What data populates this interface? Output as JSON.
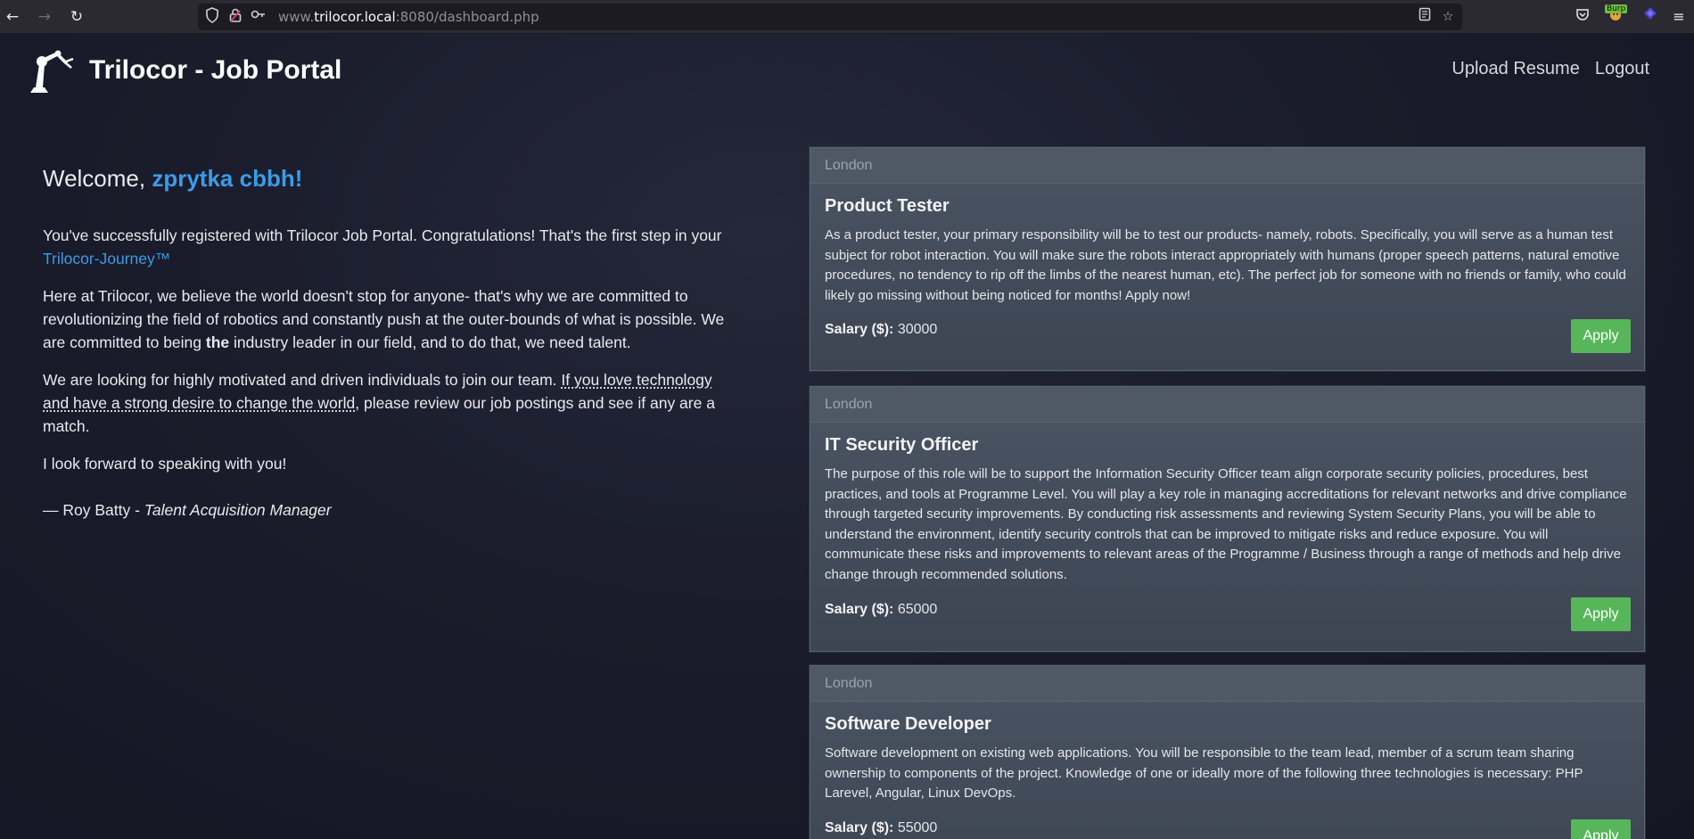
{
  "browser": {
    "url_prefix": "www.",
    "url_host": "trilocor.local",
    "url_rest": ":8080/dashboard.php",
    "burp_badge": "Burp",
    "icons": [
      "back-icon",
      "forward-icon",
      "reload-icon",
      "shield-icon",
      "lock-icon",
      "key-icon",
      "reader-icon",
      "star-icon",
      "pocket-icon",
      "burp-icon",
      "extension-icon",
      "menu-icon"
    ]
  },
  "header": {
    "brand": "Trilocor - Job Portal",
    "nav": {
      "upload": "Upload Resume",
      "logout": "Logout"
    }
  },
  "intro": {
    "welcome_prefix": "Welcome, ",
    "username": "zprytka cbbh!",
    "p1_text": "You've successfully registered with Trilocor Job Portal. Congratulations! That's the first step in your ",
    "p1_link": "Trilocor-Journey™",
    "p2_a": "Here at Trilocor, we believe the world doesn't stop for anyone- that's why we are committed to revolutionizing the field of robotics and constantly push at the outer-bounds of what is possible. We are committed to being ",
    "p2_bold": "the",
    "p2_b": " industry leader in our field, and to do that, we need talent.",
    "p3_a": "We are looking for highly motivated and driven individuals to join our team. ",
    "p3_dotted": "If you love technology and have a strong desire to change the world",
    "p3_b": ", please review our job postings and see if any are a match.",
    "p4": "I look forward to speaking with you!",
    "sig_name": "— Roy Batty - ",
    "sig_title": "Talent Acquisition Manager"
  },
  "jobs": [
    {
      "location": "London",
      "title": "Product Tester",
      "description": "As a product tester, your primary responsibility will be to test our products- namely, robots. Specifically, you will serve as a human test subject for robot interaction. You will make sure the robots interact appropriately with humans (proper speech patterns, natural emotive procedures, no tendency to rip off the limbs of the nearest human, etc). The perfect job for someone with no friends or family, who could likely go missing without being noticed for months! Apply now!",
      "salary_label": "Salary ($):",
      "salary": "30000",
      "apply": "Apply"
    },
    {
      "location": "London",
      "title": "IT Security Officer",
      "description": "The purpose of this role will be to support the Information Security Officer team align corporate security policies, procedures, best practices, and tools at Programme Level. You will play a key role in managing accreditations for relevant networks and drive compliance through targeted security improvements. By conducting risk assessments and reviewing System Security Plans, you will be able to understand the environment, identify security controls that can be improved to mitigate risks and reduce exposure. You will communicate these risks and improvements to relevant areas of the Programme / Business through a range of methods and help drive change through recommended solutions.",
      "salary_label": "Salary ($):",
      "salary": "65000",
      "apply": "Apply"
    },
    {
      "location": "London",
      "title": "Software Developer",
      "description": "Software development on existing web applications. You will be responsible to the team lead, member of a scrum team sharing ownership to components of the project. Knowledge of one or ideally more of the following three technologies is necessary: PHP Larevel, Angular, Linux DevOps.",
      "salary_label": "Salary ($):",
      "salary": "55000",
      "apply": "Apply"
    }
  ]
}
